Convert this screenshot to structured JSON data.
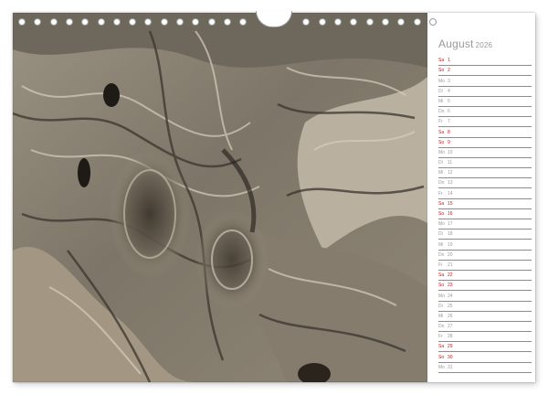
{
  "calendar": {
    "month": "August",
    "year": "2026",
    "weekend_color": "#c4161c",
    "weekday_color": "#9a9a9a",
    "days": [
      {
        "weekday": "Sa",
        "day": "1",
        "weekend": true
      },
      {
        "weekday": "So",
        "day": "2",
        "weekend": true
      },
      {
        "weekday": "Mo",
        "day": "3",
        "weekend": false
      },
      {
        "weekday": "Di",
        "day": "4",
        "weekend": false
      },
      {
        "weekday": "Mi",
        "day": "5",
        "weekend": false
      },
      {
        "weekday": "Do",
        "day": "6",
        "weekend": false
      },
      {
        "weekday": "Fr",
        "day": "7",
        "weekend": false
      },
      {
        "weekday": "Sa",
        "day": "8",
        "weekend": true
      },
      {
        "weekday": "So",
        "day": "9",
        "weekend": true
      },
      {
        "weekday": "Mo",
        "day": "10",
        "weekend": false
      },
      {
        "weekday": "Di",
        "day": "11",
        "weekend": false
      },
      {
        "weekday": "Mi",
        "day": "12",
        "weekend": false
      },
      {
        "weekday": "Do",
        "day": "13",
        "weekend": false
      },
      {
        "weekday": "Fr",
        "day": "14",
        "weekend": false
      },
      {
        "weekday": "Sa",
        "day": "15",
        "weekend": true
      },
      {
        "weekday": "So",
        "day": "16",
        "weekend": true
      },
      {
        "weekday": "Mo",
        "day": "17",
        "weekend": false
      },
      {
        "weekday": "Di",
        "day": "18",
        "weekend": false
      },
      {
        "weekday": "Mi",
        "day": "19",
        "weekend": false
      },
      {
        "weekday": "Do",
        "day": "20",
        "weekend": false
      },
      {
        "weekday": "Fr",
        "day": "21",
        "weekend": false
      },
      {
        "weekday": "Sa",
        "day": "22",
        "weekend": true
      },
      {
        "weekday": "So",
        "day": "23",
        "weekend": true
      },
      {
        "weekday": "Mo",
        "day": "24",
        "weekend": false
      },
      {
        "weekday": "Di",
        "day": "25",
        "weekend": false
      },
      {
        "weekday": "Mi",
        "day": "26",
        "weekend": false
      },
      {
        "weekday": "Do",
        "day": "27",
        "weekend": false
      },
      {
        "weekday": "Fr",
        "day": "28",
        "weekend": false
      },
      {
        "weekday": "Sa",
        "day": "29",
        "weekend": true
      },
      {
        "weekday": "So",
        "day": "30",
        "weekend": true
      },
      {
        "weekday": "Mo",
        "day": "31",
        "weekend": false
      }
    ]
  },
  "photo": {
    "subject": "weathered tree bark close-up",
    "palette": [
      "#8a8274",
      "#b5ab9a",
      "#4a443c",
      "#d8d0c0",
      "#2a2620"
    ]
  },
  "binding": {
    "hole_count": 27
  }
}
